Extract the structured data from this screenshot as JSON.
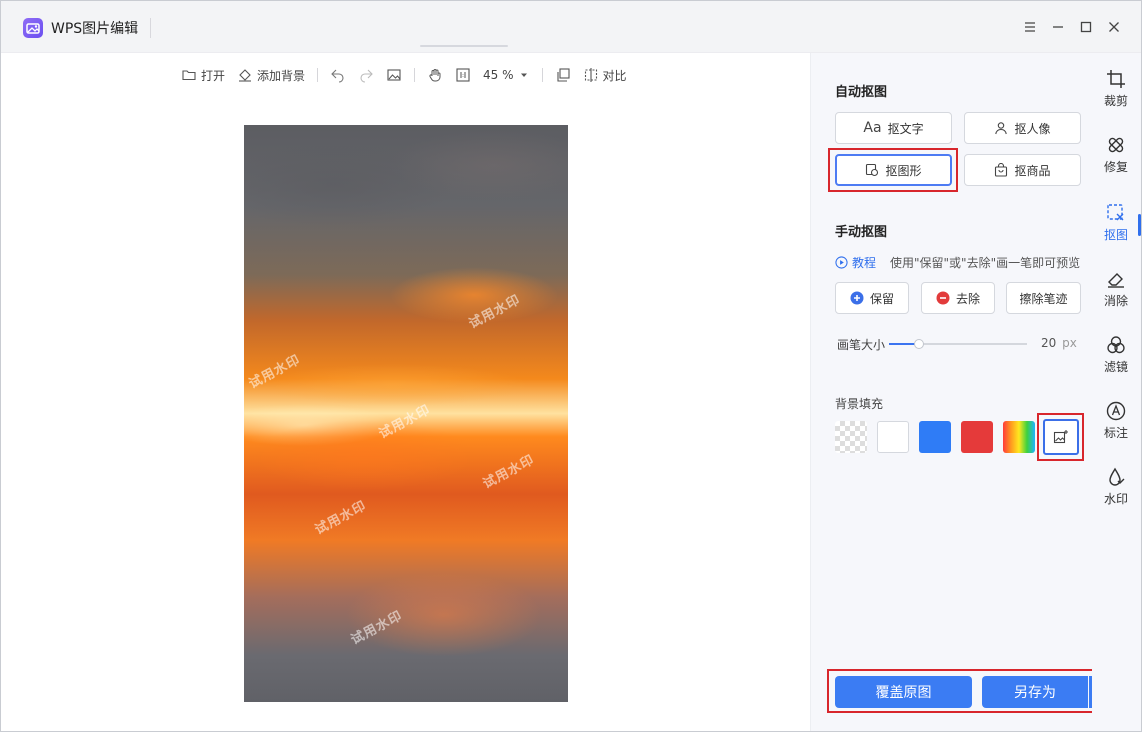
{
  "app": {
    "title": "WPS图片编辑"
  },
  "toolbar": {
    "open": "打开",
    "add_background": "添加背景",
    "zoom": "45 %",
    "compare": "对比"
  },
  "watermarks": [
    "试用水印",
    "试用水印",
    "试用水印",
    "试用水印",
    "试用水印",
    "试用水印"
  ],
  "panel": {
    "auto_cutout": {
      "title": "自动抠图",
      "buttons": [
        "抠文字",
        "抠人像",
        "抠图形",
        "抠商品"
      ],
      "text_prefix": "Aa"
    },
    "manual_cutout": {
      "title": "手动抠图",
      "tutorial": "教程",
      "hint": "使用\"保留\"或\"去除\"画一笔即可预览",
      "keep": "保留",
      "remove": "去除",
      "erase": "擦除笔迹"
    },
    "brush": {
      "label": "画笔大小",
      "value": "20",
      "unit": "px",
      "level": 0.22
    },
    "background_fill": {
      "label": "背景填充",
      "colors": [
        "transparent",
        "#ffffff",
        "#2f7cf6",
        "#e53a3a",
        "rainbow"
      ]
    },
    "actions": {
      "overwrite": "覆盖原图",
      "save_as": "另存为"
    }
  },
  "rail": [
    "裁剪",
    "修复",
    "抠图",
    "消除",
    "滤镜",
    "标注",
    "水印"
  ],
  "colors": {
    "accent": "#2f6fed",
    "highlight": "#d8262c",
    "primary_btn": "#3b7cf3"
  }
}
